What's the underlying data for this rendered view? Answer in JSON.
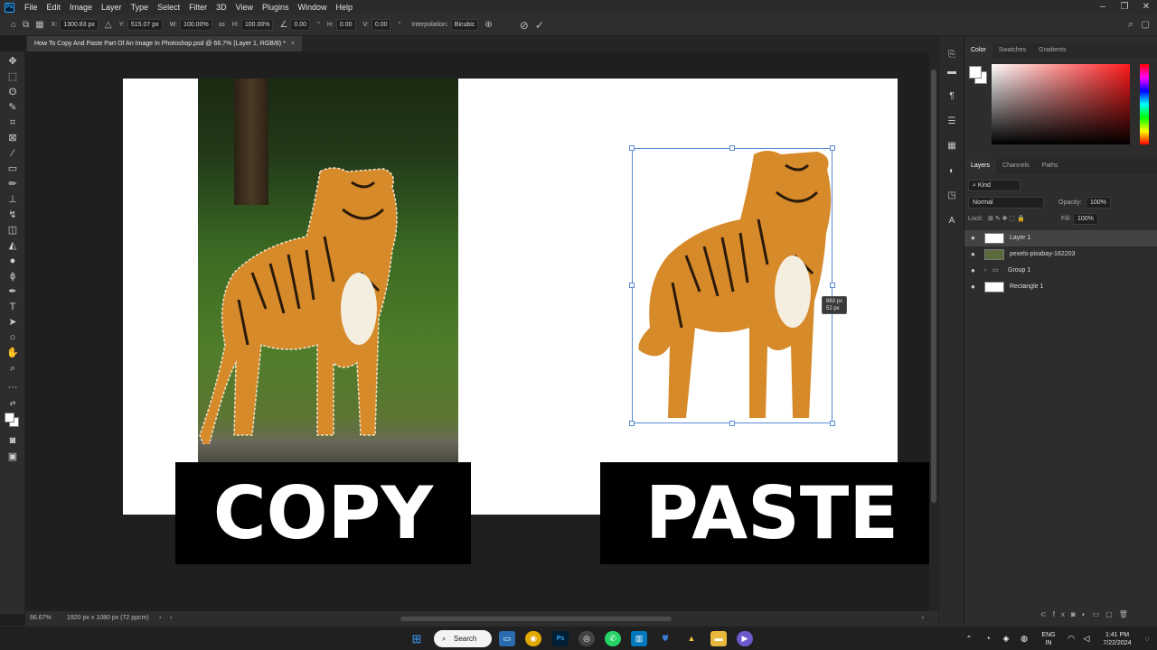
{
  "menubar": {
    "app_icon": "Ps",
    "items": [
      "File",
      "Edit",
      "Image",
      "Layer",
      "Type",
      "Select",
      "Filter",
      "3D",
      "View",
      "Plugins",
      "Window",
      "Help"
    ]
  },
  "options_bar": {
    "x_label": "X:",
    "x_value": "1300.83 px",
    "y_label": "Y:",
    "y_value": "515.07 px",
    "w_label": "W:",
    "w_value": "100.00%",
    "h_label": "H:",
    "h_value": "100.00%",
    "angle_value": "0.00",
    "angle_unit": "°",
    "hskew_label": "H:",
    "hskew_value": "0.00",
    "vskew_label": "V:",
    "vskew_value": "0.00",
    "skew_unit": "°",
    "interpolation_label": "Interpolation:",
    "interpolation_value": "Bicubic"
  },
  "document_tab": {
    "title": "How To Copy And Paste Part Of An Image In Photoshop.psd @ 66.7% (Layer 1, RGB/8) *",
    "close": "×"
  },
  "canvas": {
    "copy_text": "COPY",
    "paste_text": "PASTE",
    "measure_width": "863 px",
    "measure_height": "52 px"
  },
  "status": {
    "zoom": "66.67%",
    "doc_info": "1920 px x 1080 px (72 ppcm)"
  },
  "color_panel": {
    "tabs": [
      "Color",
      "Swatches",
      "Gradients"
    ],
    "foreground": "#ffffff",
    "background": "#ffffff"
  },
  "layers_panel": {
    "tabs": [
      "Layers",
      "Channels",
      "Paths"
    ],
    "search_placeholder": "Kind",
    "blend_mode": "Normal",
    "opacity_label": "Opacity:",
    "opacity_value": "100%",
    "lock_label": "Lock:",
    "fill_label": "Fill:",
    "fill_value": "100%",
    "layers": [
      {
        "name": "Layer 1",
        "selected": true
      },
      {
        "name": "pexels-pixabay-162203",
        "selected": false
      },
      {
        "name": "Group 1",
        "selected": false
      },
      {
        "name": "Rectangle 1",
        "selected": false
      }
    ]
  },
  "taskbar": {
    "search_label": "Search",
    "language": "ENG",
    "region": "IN",
    "time": "1:41 PM",
    "date": "7/22/2024"
  }
}
